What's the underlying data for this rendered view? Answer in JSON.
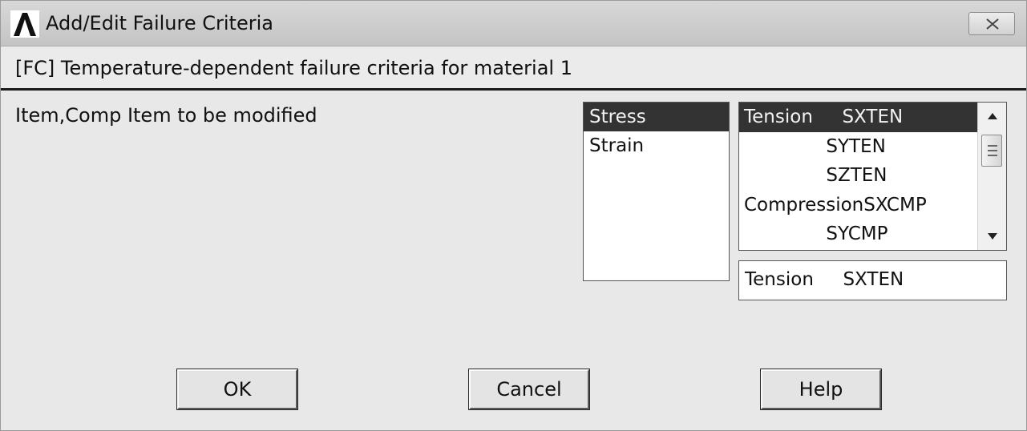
{
  "window": {
    "title": "Add/Edit Failure Criteria",
    "app_icon": "ansys-logo-icon",
    "close_icon": "close-icon"
  },
  "header": {
    "text": "[FC] Temperature-dependent failure criteria for material 1"
  },
  "form": {
    "label": "Item,Comp  Item to be modified",
    "items": [
      {
        "label": "Stress",
        "selected": true
      },
      {
        "label": "Strain",
        "selected": false
      }
    ],
    "components": [
      {
        "label": "Tension     SXTEN",
        "selected": true
      },
      {
        "label": "              SYTEN",
        "selected": false
      },
      {
        "label": "              SZTEN",
        "selected": false
      },
      {
        "label": "CompressionSXCMP",
        "selected": false
      },
      {
        "label": "              SYCMP",
        "selected": false
      }
    ],
    "selected_component": "Tension     SXTEN"
  },
  "buttons": {
    "ok": "OK",
    "cancel": "Cancel",
    "help": "Help"
  },
  "colors": {
    "selection_bg": "#333333",
    "header_rule": "#1a1a1a"
  }
}
